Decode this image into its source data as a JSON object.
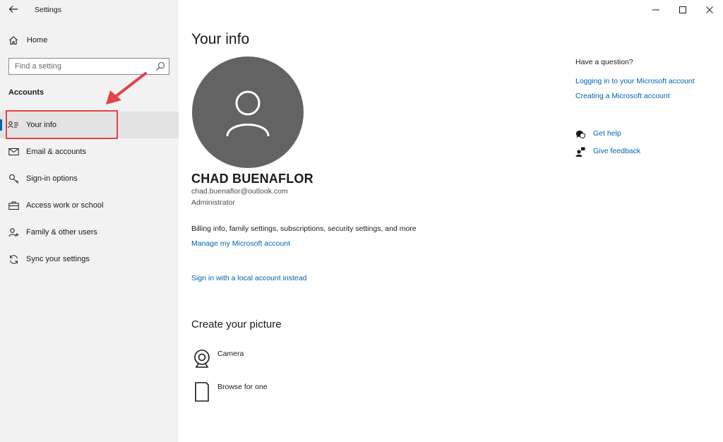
{
  "window": {
    "title": "Settings",
    "controls": {
      "minimize": "–",
      "maximize": "☐",
      "close": "✕"
    }
  },
  "sidebar": {
    "home_label": "Home",
    "search_placeholder": "Find a setting",
    "section_heading": "Accounts",
    "items": [
      {
        "label": "Your info",
        "icon": "person-card-icon",
        "selected": true
      },
      {
        "label": "Email & accounts",
        "icon": "mail-icon",
        "selected": false
      },
      {
        "label": "Sign-in options",
        "icon": "key-icon",
        "selected": false
      },
      {
        "label": "Access work or school",
        "icon": "briefcase-icon",
        "selected": false
      },
      {
        "label": "Family & other users",
        "icon": "person-add-icon",
        "selected": false
      },
      {
        "label": "Sync your settings",
        "icon": "sync-icon",
        "selected": false
      }
    ]
  },
  "main": {
    "title": "Your info",
    "user": {
      "name": "CHAD BUENAFLOR",
      "email": "chad.buenaflor@outlook.com",
      "role": "Administrator"
    },
    "billing_text": "Billing info, family settings, subscriptions, security settings, and more",
    "manage_link": "Manage my Microsoft account",
    "local_account_link": "Sign in with a local account instead",
    "picture_section": {
      "title": "Create your picture",
      "options": [
        {
          "label": "Camera",
          "icon": "camera-icon"
        },
        {
          "label": "Browse for one",
          "icon": "file-icon"
        }
      ]
    }
  },
  "help_panel": {
    "heading": "Have a question?",
    "links": [
      "Logging in to your Microsoft account",
      "Creating a Microsoft account"
    ],
    "get_help": "Get help",
    "give_feedback": "Give feedback"
  },
  "colors": {
    "accent": "#0063b1",
    "sidebar_bg": "#f2f2f2",
    "avatar_bg": "#636363",
    "annotation": "#e0454a"
  }
}
